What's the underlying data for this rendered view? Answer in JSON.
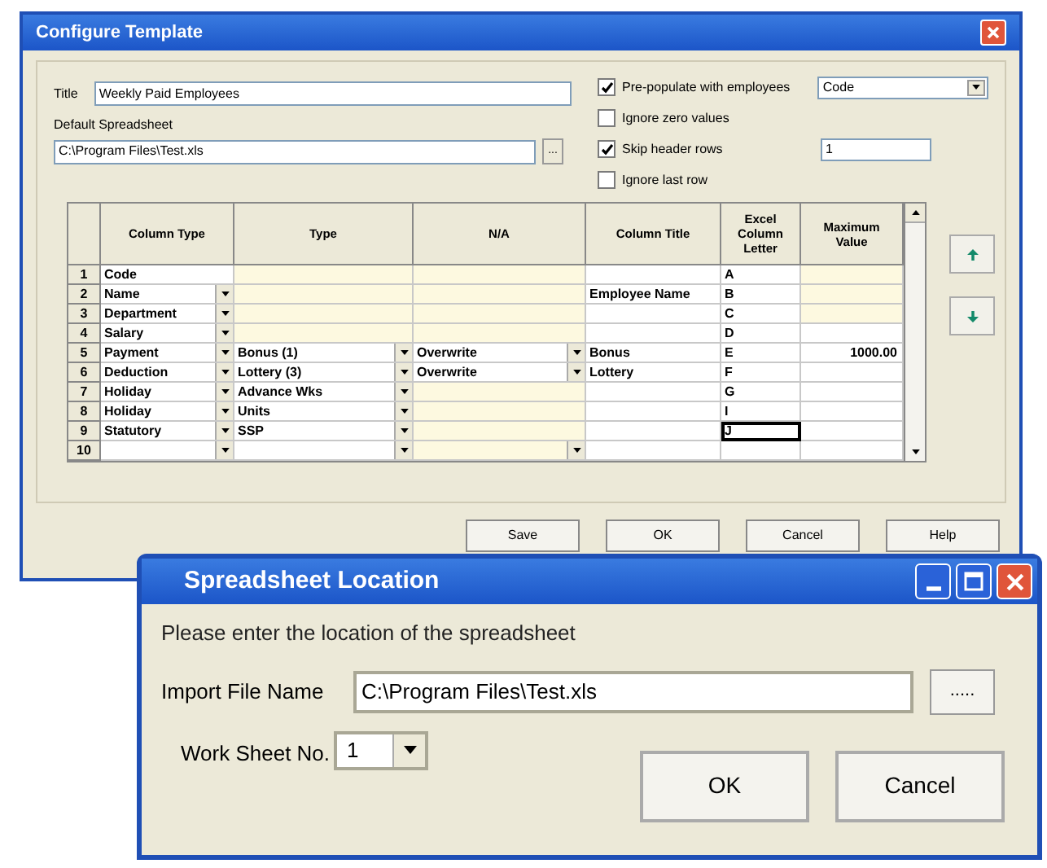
{
  "configure_window": {
    "title": "Configure Template",
    "title_label": "Title",
    "title_value": "Weekly Paid Employees",
    "spreadsheet_label": "Default Spreadsheet",
    "spreadsheet_value": "C:\\Program Files\\Test.xls",
    "browse_label": "...",
    "options": [
      {
        "label": "Pre-populate with employees",
        "checked": true,
        "kind": "select",
        "value": "Code"
      },
      {
        "label": "Ignore zero values",
        "checked": false
      },
      {
        "label": "Skip header rows",
        "checked": true,
        "kind": "field",
        "value": "1"
      },
      {
        "label": "Ignore last row",
        "checked": false
      }
    ],
    "table": {
      "columns": [
        "Column Type",
        "Type",
        "N/A",
        "Column Title",
        "Excel Column Letter",
        "Maximum Value"
      ],
      "rows": [
        {
          "number": "1",
          "cells": [
            {
              "text": "Code",
              "dropdown": false,
              "shaded": false,
              "selected": false
            },
            {
              "dropdown": false,
              "shaded": true,
              "selected": false
            },
            {
              "dropdown": false,
              "shaded": true,
              "selected": false
            },
            {
              "dropdown": false,
              "shaded": false,
              "selected": false
            },
            {
              "text": "A",
              "dropdown": false,
              "shaded": false,
              "selected": false
            },
            {
              "dropdown": false,
              "shaded": true,
              "selected": false
            }
          ]
        },
        {
          "number": "2",
          "cells": [
            {
              "text": "Name",
              "dropdown": true,
              "shaded": false,
              "selected": false
            },
            {
              "dropdown": false,
              "shaded": true,
              "selected": false
            },
            {
              "dropdown": false,
              "shaded": true,
              "selected": false
            },
            {
              "text": "Employee Name",
              "dropdown": false,
              "shaded": false,
              "selected": false
            },
            {
              "text": "B",
              "dropdown": false,
              "shaded": false,
              "selected": false
            },
            {
              "dropdown": false,
              "shaded": true,
              "selected": false
            }
          ]
        },
        {
          "number": "3",
          "cells": [
            {
              "text": "Department",
              "dropdown": true,
              "shaded": false,
              "selected": false
            },
            {
              "dropdown": false,
              "shaded": true,
              "selected": false
            },
            {
              "dropdown": false,
              "shaded": true,
              "selected": false
            },
            {
              "dropdown": false,
              "shaded": false,
              "selected": false
            },
            {
              "text": "C",
              "dropdown": false,
              "shaded": false,
              "selected": false
            },
            {
              "dropdown": false,
              "shaded": true,
              "selected": false
            }
          ]
        },
        {
          "number": "4",
          "cells": [
            {
              "text": "Salary",
              "dropdown": true,
              "shaded": false,
              "selected": false
            },
            {
              "dropdown": false,
              "shaded": true,
              "selected": false
            },
            {
              "dropdown": false,
              "shaded": true,
              "selected": false
            },
            {
              "dropdown": false,
              "shaded": false,
              "selected": false
            },
            {
              "text": "D",
              "dropdown": false,
              "shaded": false,
              "selected": false
            },
            {
              "dropdown": false,
              "shaded": false,
              "selected": false
            }
          ]
        },
        {
          "number": "5",
          "cells": [
            {
              "text": "Payment",
              "dropdown": true,
              "shaded": false,
              "selected": false
            },
            {
              "text": "Bonus (1)",
              "dropdown": true,
              "shaded": false,
              "selected": false
            },
            {
              "text": "Overwrite",
              "dropdown": true,
              "shaded": false,
              "selected": false
            },
            {
              "text": "Bonus",
              "dropdown": false,
              "shaded": false,
              "selected": false
            },
            {
              "text": "E",
              "dropdown": false,
              "shaded": false,
              "selected": false
            },
            {
              "text": "1000.00",
              "dropdown": false,
              "shaded": false,
              "selected": false
            }
          ]
        },
        {
          "number": "6",
          "cells": [
            {
              "text": "Deduction",
              "dropdown": true,
              "shaded": false,
              "selected": false
            },
            {
              "text": "Lottery (3)",
              "dropdown": true,
              "shaded": false,
              "selected": false
            },
            {
              "text": "Overwrite",
              "dropdown": true,
              "shaded": false,
              "selected": false
            },
            {
              "text": "Lottery",
              "dropdown": false,
              "shaded": false,
              "selected": false
            },
            {
              "text": "F",
              "dropdown": false,
              "shaded": false,
              "selected": false
            },
            {
              "dropdown": false,
              "shaded": false,
              "selected": false
            }
          ]
        },
        {
          "number": "7",
          "cells": [
            {
              "text": "Holiday",
              "dropdown": true,
              "shaded": false,
              "selected": false
            },
            {
              "text": "Advance Wks",
              "dropdown": true,
              "shaded": false,
              "selected": false
            },
            {
              "dropdown": false,
              "shaded": true,
              "selected": false
            },
            {
              "dropdown": false,
              "shaded": false,
              "selected": false
            },
            {
              "text": "G",
              "dropdown": false,
              "shaded": false,
              "selected": false
            },
            {
              "dropdown": false,
              "shaded": false,
              "selected": false
            }
          ]
        },
        {
          "number": "8",
          "cells": [
            {
              "text": "Holiday",
              "dropdown": true,
              "shaded": false,
              "selected": false
            },
            {
              "text": "Units",
              "dropdown": true,
              "shaded": false,
              "selected": false
            },
            {
              "dropdown": false,
              "shaded": true,
              "selected": false
            },
            {
              "dropdown": false,
              "shaded": false,
              "selected": false
            },
            {
              "text": "I",
              "dropdown": false,
              "shaded": false,
              "selected": false
            },
            {
              "dropdown": false,
              "shaded": false,
              "selected": false
            }
          ]
        },
        {
          "number": "9",
          "cells": [
            {
              "text": "Statutory",
              "dropdown": true,
              "shaded": false,
              "selected": false
            },
            {
              "text": "SSP",
              "dropdown": true,
              "shaded": false,
              "selected": false
            },
            {
              "dropdown": false,
              "shaded": true,
              "selected": false
            },
            {
              "dropdown": false,
              "shaded": false,
              "selected": false
            },
            {
              "text": "J",
              "dropdown": false,
              "shaded": false,
              "selected": true
            },
            {
              "dropdown": false,
              "shaded": false,
              "selected": false
            }
          ]
        },
        {
          "number": "10",
          "cells": [
            {
              "dropdown": true,
              "shaded": false,
              "selected": false
            },
            {
              "dropdown": true,
              "shaded": false,
              "selected": false
            },
            {
              "dropdown": true,
              "shaded": true,
              "selected": false
            },
            {
              "dropdown": false,
              "shaded": false,
              "selected": false
            },
            {
              "dropdown": false,
              "shaded": false,
              "selected": false
            },
            {
              "dropdown": false,
              "shaded": false,
              "selected": false
            }
          ]
        }
      ]
    },
    "buttons": [
      "Save",
      "OK",
      "Cancel",
      "Help"
    ]
  },
  "location_window": {
    "title": "Spreadsheet Location",
    "prompt": "Please enter the location of the spreadsheet",
    "file_label": "Import File Name",
    "file_value": "C:\\Program Files\\Test.xls",
    "browse_label": ".....",
    "sheet_label": "Work Sheet No.",
    "sheet_value": "1",
    "buttons": [
      "OK",
      "Cancel"
    ]
  }
}
